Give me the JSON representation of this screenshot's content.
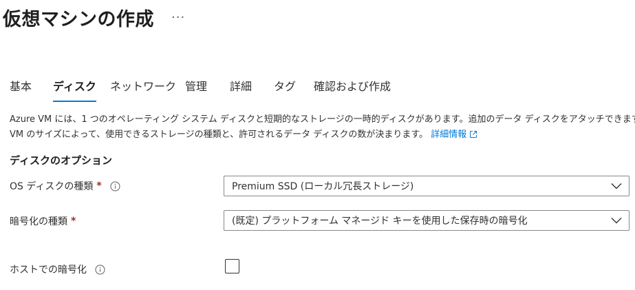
{
  "header": {
    "title": "仮想マシンの作成",
    "more_label": "..."
  },
  "tabs": [
    {
      "label": "基本",
      "active": false
    },
    {
      "label": "ディスク",
      "active": true
    },
    {
      "label": "ネットワーク",
      "active": false
    },
    {
      "label": "管理",
      "active": false
    },
    {
      "label": "詳細",
      "active": false
    },
    {
      "label": "タグ",
      "active": false
    },
    {
      "label": "確認および作成",
      "active": false
    }
  ],
  "description": {
    "line1": "Azure VM には、1 つのオペレーティング システム ディスクと短期的なストレージの一時的ディスクがあります。追加のデータ ディスクをアタッチできます",
    "line2": "VM のサイズによって、使用できるストレージの種類と、許可されるデータ ディスクの数が決まります。",
    "link": "詳細情報",
    "link_icon": "external-link-icon"
  },
  "section": {
    "title": "ディスクのオプション"
  },
  "fields": {
    "os_disk_type": {
      "label": "OS ディスクの種類",
      "required_mark": "*",
      "info_icon": "info-icon",
      "value": "Premium SSD (ローカル冗長ストレージ)"
    },
    "encryption_type": {
      "label": "暗号化の種類",
      "required_mark": "*",
      "value": "(既定) プラットフォーム マネージド キーを使用した保存時の暗号化"
    },
    "host_encryption": {
      "label": "ホストでの暗号化",
      "info_icon": "info-icon",
      "checked": false
    }
  },
  "colors": {
    "accent": "#0078d4",
    "required": "#a4262c",
    "text": "#323130",
    "border": "#8a8886"
  }
}
